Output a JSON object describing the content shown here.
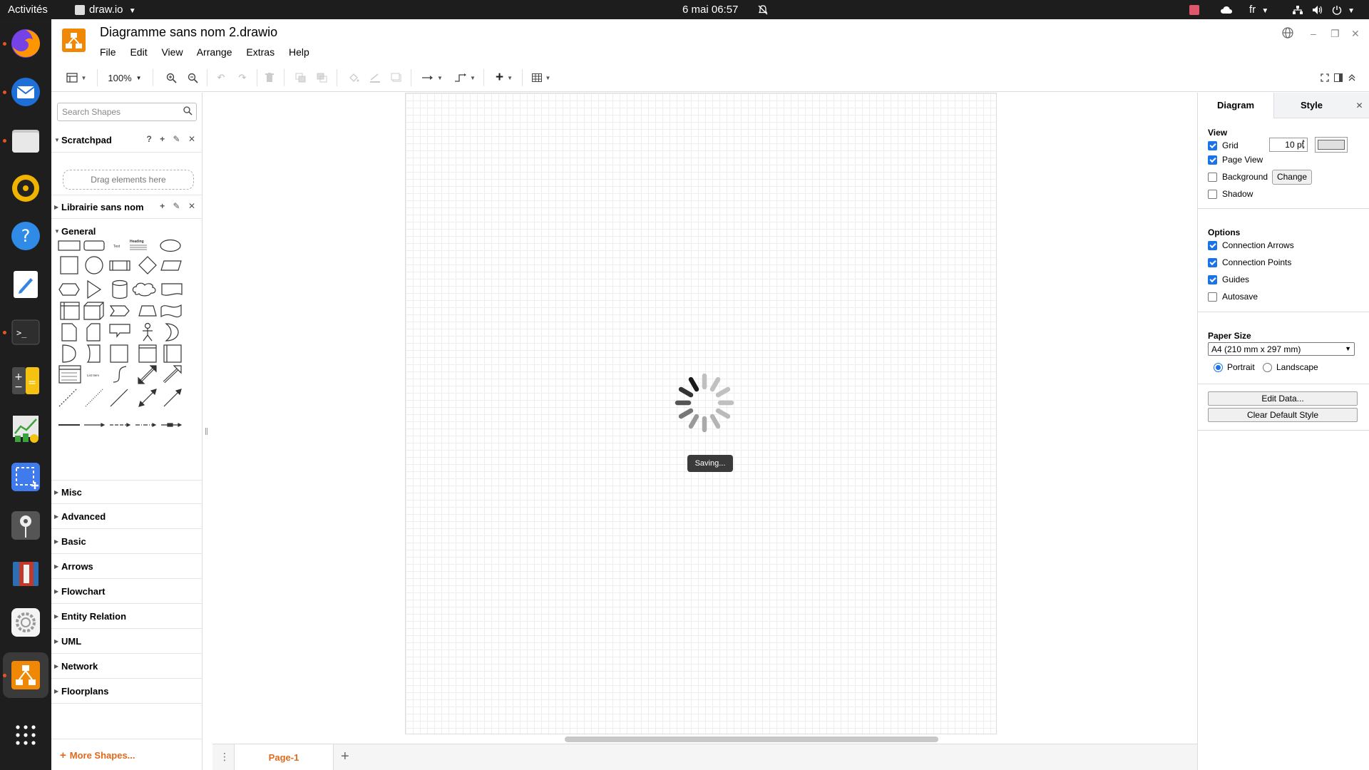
{
  "topbar": {
    "activities": "Activités",
    "app_name": "draw.io",
    "clock": "6 mai  06:57",
    "lang": "fr"
  },
  "window": {
    "title": "Diagramme sans nom 2.drawio"
  },
  "menu": [
    "File",
    "Edit",
    "View",
    "Arrange",
    "Extras",
    "Help"
  ],
  "toolbar": {
    "zoom": "100%"
  },
  "sidebar": {
    "search_placeholder": "Search Shapes",
    "scratchpad_title": "Scratchpad",
    "scratchpad_help": "?",
    "drag_here": "Drag elements here",
    "library_title": "Librairie sans nom",
    "general_title": "General",
    "shape_text_label": "Text",
    "shape_heading_label": "Heading",
    "shape_list_item_label": "List Item",
    "sections": [
      "Misc",
      "Advanced",
      "Basic",
      "Arrows",
      "Flowchart",
      "Entity Relation",
      "UML",
      "Network",
      "Floorplans"
    ],
    "more_shapes": "More Shapes..."
  },
  "canvas": {
    "status": "Saving..."
  },
  "pages": {
    "active": "Page-1"
  },
  "format": {
    "tab_diagram": "Diagram",
    "tab_style": "Style",
    "view_title": "View",
    "grid_label": "Grid",
    "grid_checked": true,
    "grid_size": "10 pt",
    "grid_color": "#e0e0e0",
    "page_view_label": "Page View",
    "page_view_checked": true,
    "background_label": "Background",
    "background_checked": false,
    "change_button": "Change",
    "shadow_label": "Shadow",
    "shadow_checked": false,
    "options_title": "Options",
    "connection_arrows_label": "Connection Arrows",
    "connection_arrows_checked": true,
    "connection_points_label": "Connection Points",
    "connection_points_checked": true,
    "guides_label": "Guides",
    "guides_checked": true,
    "autosave_label": "Autosave",
    "autosave_checked": false,
    "paper_size_title": "Paper Size",
    "paper_size_value": "A4 (210 mm x 297 mm)",
    "portrait_label": "Portrait",
    "landscape_label": "Landscape",
    "orientation": "Portrait",
    "edit_data_button": "Edit Data...",
    "clear_default_style_button": "Clear Default Style"
  },
  "colors": {
    "accent": "#e0691a",
    "logo": "#f08705",
    "checkbox": "#1a73e8",
    "dock_indicator": "#e95420"
  }
}
